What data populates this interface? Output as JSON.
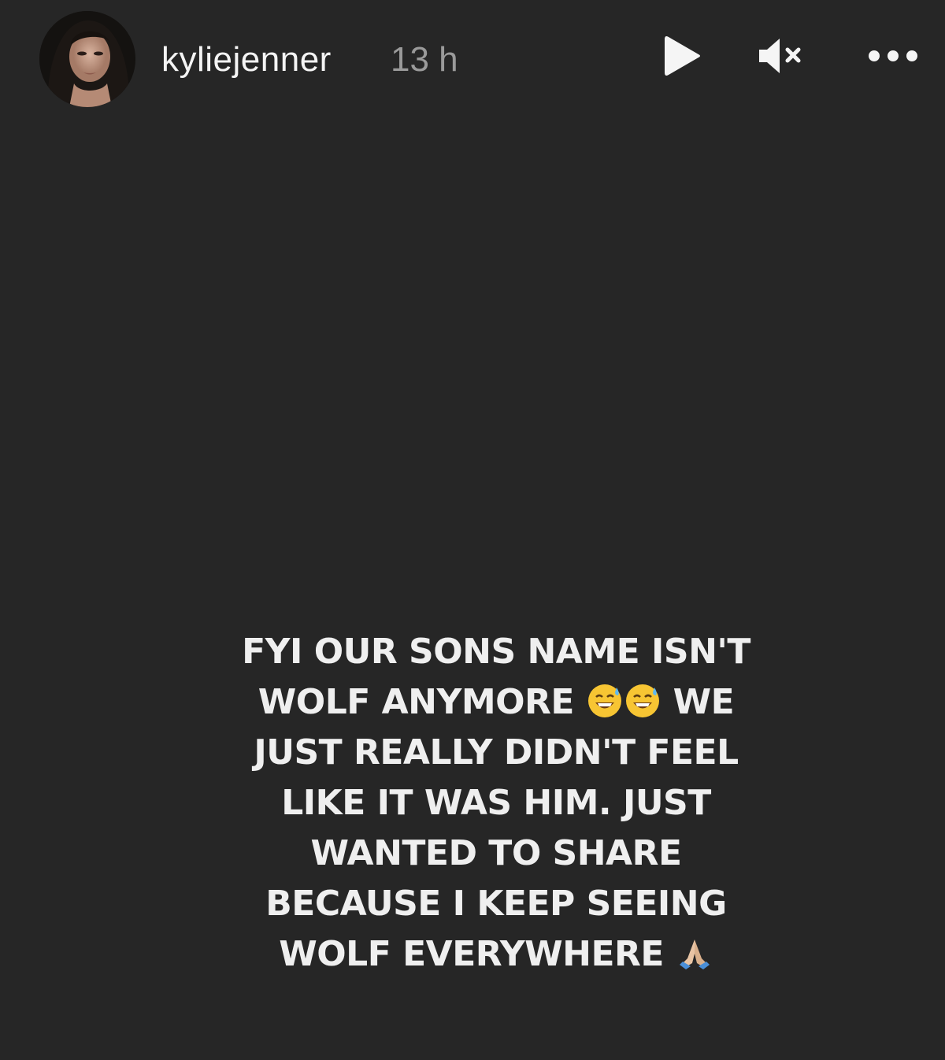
{
  "story": {
    "username": "kyliejenner",
    "timestamp": "13 h",
    "avatar_icon": "profile-photo",
    "controls": {
      "play_icon": "play-icon",
      "mute_icon": "muted-speaker-icon",
      "more_icon": "more-options-icon"
    },
    "caption": {
      "line1": "FYI OUR SONS NAME ISN'T",
      "line2_a": "WOLF ANYMORE",
      "line2_emoji": "sweat-smile-emoji",
      "line2_b": "WE",
      "line3": "JUST REALLY DIDN'T FEEL",
      "line4": "LIKE IT WAS HIM. JUST",
      "line5": "WANTED TO SHARE",
      "line6": "BECAUSE I KEEP SEEING",
      "line7": "WOLF EVERYWHERE",
      "line7_emoji": "folded-hands-emoji"
    }
  },
  "colors": {
    "background": "#262626",
    "text": "#efefef",
    "timestamp": "#9a9a9a"
  }
}
